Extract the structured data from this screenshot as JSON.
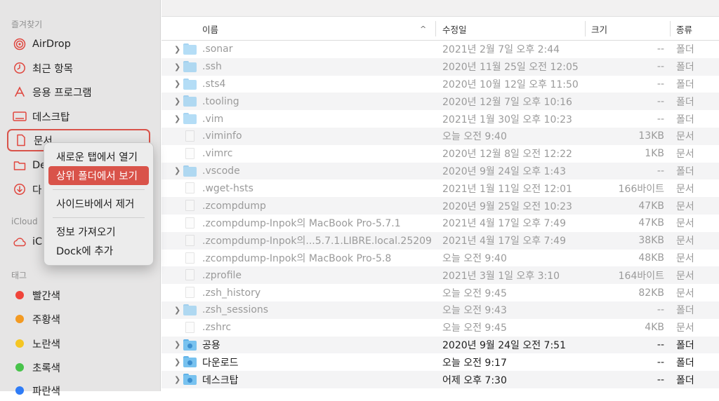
{
  "sidebar": {
    "favorites_header": "즐겨찾기",
    "favorites": [
      {
        "label": "AirDrop",
        "icon": "airdrop-icon"
      },
      {
        "label": "최근 항목",
        "icon": "clock-icon"
      },
      {
        "label": "응용 프로그램",
        "icon": "applications-icon"
      },
      {
        "label": "데스크탑",
        "icon": "desktop-icon"
      },
      {
        "label": "문서",
        "icon": "document-icon"
      },
      {
        "label": "De",
        "icon": "folder-icon"
      },
      {
        "label": "다",
        "icon": "download-icon"
      }
    ],
    "icloud_header": "iCloud",
    "icloud_item": {
      "label": "iC",
      "icon": "cloud-icon"
    },
    "tags_header": "태그",
    "tags": [
      {
        "label": "빨간색",
        "color": "#f0443a"
      },
      {
        "label": "주황색",
        "color": "#f39a22"
      },
      {
        "label": "노란색",
        "color": "#f5c623"
      },
      {
        "label": "초록색",
        "color": "#48c34b"
      },
      {
        "label": "파란색",
        "color": "#2f7cf6"
      }
    ]
  },
  "context_menu": {
    "items": [
      {
        "label": "새로운 탭에서 열기"
      },
      {
        "label": "상위 폴더에서 보기",
        "active": true
      },
      {
        "label": "사이드바에서 제거"
      },
      {
        "label": "정보 가져오기"
      },
      {
        "label": "Dock에 추가"
      }
    ]
  },
  "columns": {
    "name": "이름",
    "modified": "수정일",
    "size": "크기",
    "kind": "종류",
    "sort_indicator": "^"
  },
  "files": [
    {
      "name": ".sonar",
      "date": "2021년 2월 7일 오후 2:44",
      "size": "--",
      "kind": "폴더",
      "type": "folder",
      "dim": true
    },
    {
      "name": ".ssh",
      "date": "2020년 11월 25일 오전 12:05",
      "size": "--",
      "kind": "폴더",
      "type": "folder",
      "dim": true
    },
    {
      "name": ".sts4",
      "date": "2020년 10월 12일 오후 11:50",
      "size": "--",
      "kind": "폴더",
      "type": "folder",
      "dim": true
    },
    {
      "name": ".tooling",
      "date": "2020년 12월 7일 오후 10:16",
      "size": "--",
      "kind": "폴더",
      "type": "folder",
      "dim": true
    },
    {
      "name": ".vim",
      "date": "2021년 1월 30일 오후 10:23",
      "size": "--",
      "kind": "폴더",
      "type": "folder",
      "dim": true
    },
    {
      "name": ".viminfo",
      "date": "오늘 오전 9:40",
      "size": "13KB",
      "kind": "문서",
      "type": "doc",
      "dim": true
    },
    {
      "name": ".vimrc",
      "date": "2020년 12월 8일 오전 12:22",
      "size": "1KB",
      "kind": "문서",
      "type": "doc",
      "dim": true
    },
    {
      "name": ".vscode",
      "date": "2020년 9월 24일 오후 1:43",
      "size": "--",
      "kind": "폴더",
      "type": "folder",
      "dim": true
    },
    {
      "name": ".wget-hsts",
      "date": "2021년 1월 11일 오전 12:01",
      "size": "166바이트",
      "kind": "문서",
      "type": "doc",
      "dim": true
    },
    {
      "name": ".zcompdump",
      "date": "2020년 9월 25일 오전 10:23",
      "size": "47KB",
      "kind": "문서",
      "type": "doc",
      "dim": true
    },
    {
      "name": ".zcompdump-Inpok의 MacBook Pro-5.7.1",
      "date": "2021년 4월 17일 오후 7:49",
      "size": "47KB",
      "kind": "문서",
      "type": "doc",
      "dim": true
    },
    {
      "name": ".zcompdump-Inpok의...5.7.1.LIBRE.local.25209",
      "date": "2021년 4월 17일 오후 7:49",
      "size": "38KB",
      "kind": "문서",
      "type": "doc",
      "dim": true
    },
    {
      "name": ".zcompdump-Inpok의 MacBook Pro-5.8",
      "date": "오늘 오전 9:40",
      "size": "48KB",
      "kind": "문서",
      "type": "doc",
      "dim": true
    },
    {
      "name": ".zprofile",
      "date": "2021년 3월 1일 오후 3:10",
      "size": "164바이트",
      "kind": "문서",
      "type": "doc",
      "dim": true
    },
    {
      "name": ".zsh_history",
      "date": "오늘 오전 9:45",
      "size": "82KB",
      "kind": "문서",
      "type": "doc",
      "dim": true
    },
    {
      "name": ".zsh_sessions",
      "date": "오늘 오전 9:43",
      "size": "--",
      "kind": "폴더",
      "type": "folder",
      "dim": true
    },
    {
      "name": ".zshrc",
      "date": "오늘 오전 9:45",
      "size": "4KB",
      "kind": "문서",
      "type": "doc",
      "dim": true
    },
    {
      "name": "공용",
      "date": "2020년 9월 24일 오전 7:51",
      "size": "--",
      "kind": "폴더",
      "type": "folder",
      "dim": false
    },
    {
      "name": "다운로드",
      "date": "오늘 오전 9:17",
      "size": "--",
      "kind": "폴더",
      "type": "folder",
      "dim": false
    },
    {
      "name": "데스크탑",
      "date": "어제 오후 7:30",
      "size": "--",
      "kind": "폴더",
      "type": "folder",
      "dim": false
    }
  ]
}
